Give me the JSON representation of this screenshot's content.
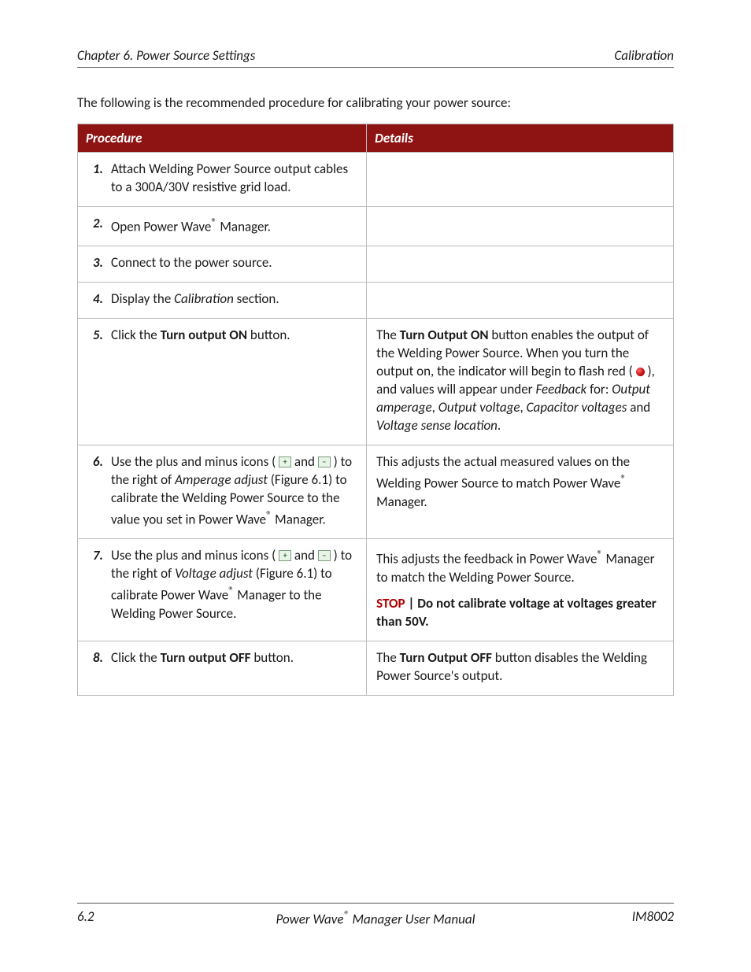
{
  "header": {
    "left": "Chapter 6. Power Source Settings",
    "right": "Calibration"
  },
  "intro": "The following is the recommended procedure for calibrating your power source:",
  "table": {
    "col_procedure": "Procedure",
    "col_details": "Details"
  },
  "steps": {
    "s1": {
      "num": "1.",
      "text": "Attach Welding Power Source output cables to a 300A/30V resistive grid load."
    },
    "s2": {
      "num": "2.",
      "pre": "Open Power Wave",
      "reg": "®",
      "post": " Manager."
    },
    "s3": {
      "num": "3.",
      "text": "Connect to the power source."
    },
    "s4": {
      "num": "4.",
      "pre": "Display the ",
      "ital": "Calibration",
      "post": " section."
    },
    "s5": {
      "num": "5.",
      "pre": "Click the ",
      "bold": "Turn output ON",
      "post": " button."
    },
    "s6": {
      "num": "6.",
      "a": "Use the plus and minus icons ( ",
      "b": " and ",
      "c": " ) to the right of ",
      "ital": "Amperage adjust",
      "d": " (Figure 6.1) to calibrate the Welding Power Source to the value you set in Power Wave",
      "reg": "®",
      "e": " Manager."
    },
    "s7": {
      "num": "7.",
      "a": "Use the plus and minus icons ( ",
      "b": " and ",
      "c": " ) to the right of ",
      "ital": "Voltage adjust",
      "d": " (Figure 6.1) to calibrate Power Wave",
      "reg": "®",
      "e": " Manager to the Welding Power Source."
    },
    "s8": {
      "num": "8.",
      "pre": "Click the ",
      "bold": "Turn output OFF",
      "post": " button."
    }
  },
  "details": {
    "d5": {
      "a": "The ",
      "bold1": "Turn Output ON",
      "b": " button enables the output of the Welding Power Source.  When you turn the output on, the indicator will begin to flash red ( ",
      "c": " ), and values will appear under ",
      "ital1": "Feedback",
      "d": " for: ",
      "ital2": "Output amperage",
      "e": ", ",
      "ital3": "Output voltage",
      "f": ", ",
      "ital4": "Capacitor voltages",
      "g": " and ",
      "ital5": "Voltage sense location",
      "h": "."
    },
    "d6": {
      "a": "This adjusts the actual measured values on the Welding Power Source to match Power Wave",
      "reg": "®",
      "b": " Manager."
    },
    "d7": {
      "a": "This adjusts the feedback in Power Wave",
      "reg": "®",
      "b": " Manager to match the Welding Power Source.",
      "stop": "STOP",
      "sep": "   |   ",
      "warn": "Do not calibrate voltage at voltages greater than 50V."
    },
    "d8": {
      "a": "The ",
      "bold": "Turn Output OFF",
      "b": " button disables the Welding Power Source's output."
    }
  },
  "footer": {
    "left": "6.2",
    "center_a": "Power Wave",
    "center_reg": "®",
    "center_b": " Manager User Manual",
    "right": "IM8002"
  },
  "icons": {
    "plus": "+",
    "minus": "−"
  }
}
